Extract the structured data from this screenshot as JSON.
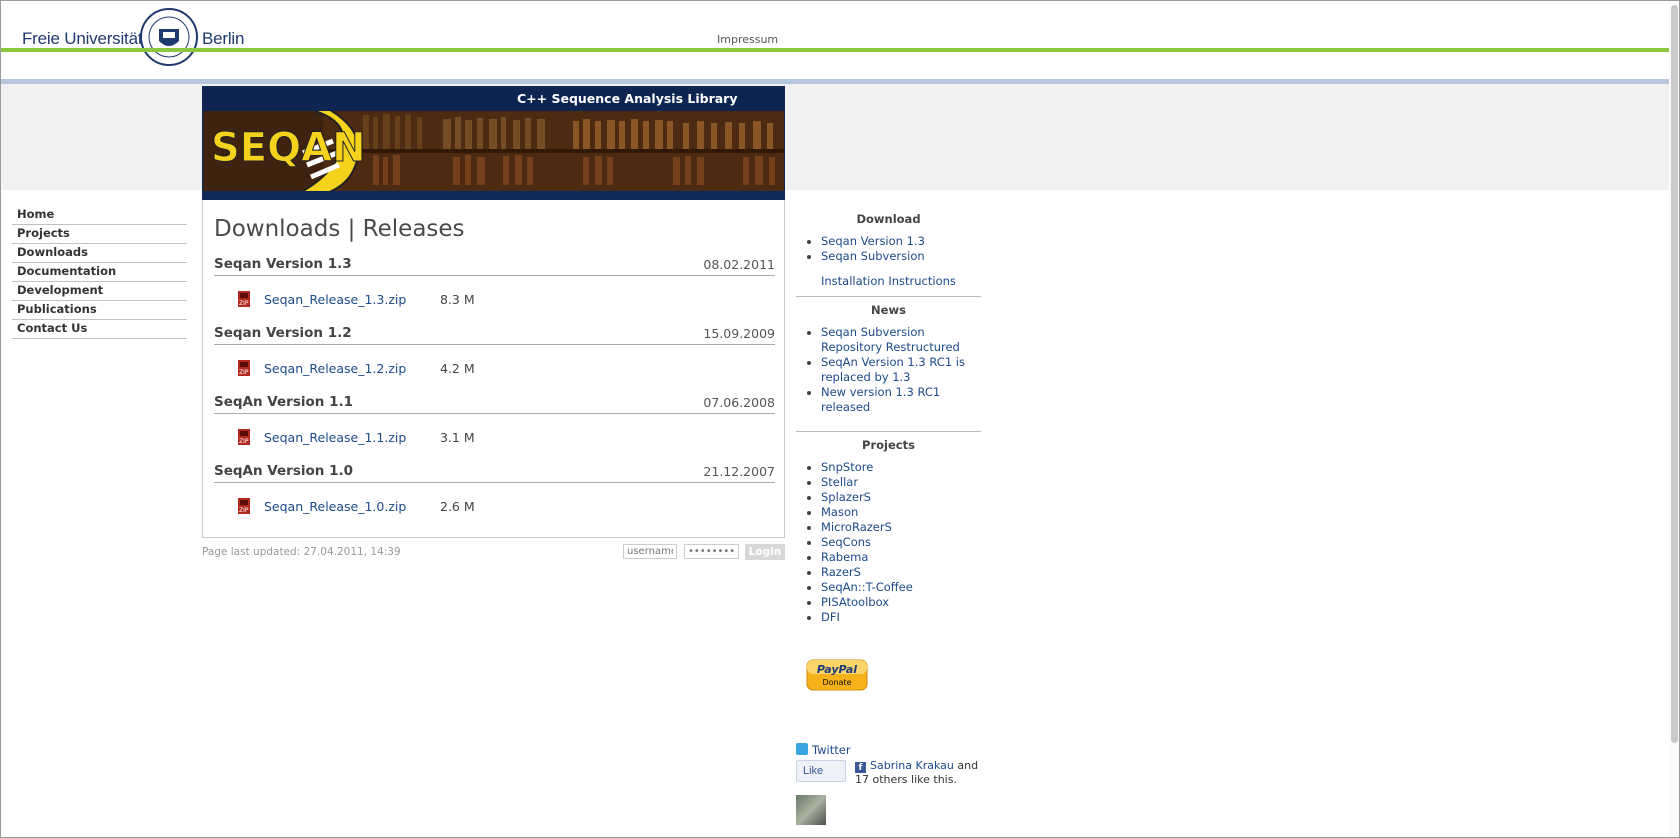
{
  "header": {
    "logo_left": "Freie Universität",
    "logo_right": "Berlin",
    "impressum": "Impressum"
  },
  "banner": {
    "title": "C++ Sequence Analysis Library",
    "logo_text": "SEQAN"
  },
  "nav": {
    "items": [
      "Home",
      "Projects",
      "Downloads",
      "Documentation",
      "Development",
      "Publications",
      "Contact Us"
    ]
  },
  "content": {
    "title": "Downloads | Releases",
    "releases": [
      {
        "name": "Seqan Version 1.3",
        "date": "08.02.2011",
        "file": "Seqan_Release_1.3.zip",
        "size": "8.3 M"
      },
      {
        "name": "Seqan Version 1.2",
        "date": "15.09.2009",
        "file": "Seqan_Release_1.2.zip",
        "size": "4.2 M"
      },
      {
        "name": "SeqAn Version 1.1",
        "date": "07.06.2008",
        "file": "Seqan_Release_1.1.zip",
        "size": "3.1 M"
      },
      {
        "name": "SeqAn Version 1.0",
        "date": "21.12.2007",
        "file": "Seqan_Release_1.0.zip",
        "size": "2.6 M"
      }
    ]
  },
  "footer": {
    "updated": "Page last updated: 27.04.2011, 14:39",
    "username_placeholder": "username",
    "password_placeholder": "••••••••",
    "login_label": "Login"
  },
  "sidebar": {
    "download": {
      "heading": "Download",
      "links": [
        "Seqan Version 1.3",
        "Seqan Subversion"
      ],
      "install": "Installation Instructions"
    },
    "news": {
      "heading": "News",
      "links": [
        "Seqan Subversion Repository Restructured",
        "SeqAn Version 1.3 RC1 is replaced by 1.3",
        "New version 1.3 RC1 released"
      ]
    },
    "projects": {
      "heading": "Projects",
      "links": [
        "SnpStore",
        "Stellar",
        "SplazerS",
        "Mason",
        "MicroRazerS",
        "SeqCons",
        "Rabema",
        "RazerS",
        "SeqAn::T-Coffee",
        "PISAtoolbox",
        "DFI"
      ]
    },
    "paypal": {
      "brand": "PayPal",
      "label": "Donate"
    },
    "twitter": "Twitter",
    "facebook": {
      "like": "Like",
      "person": "Sabrina Krakau",
      "text_and": " and",
      "text_rest": "17 others like this."
    }
  }
}
